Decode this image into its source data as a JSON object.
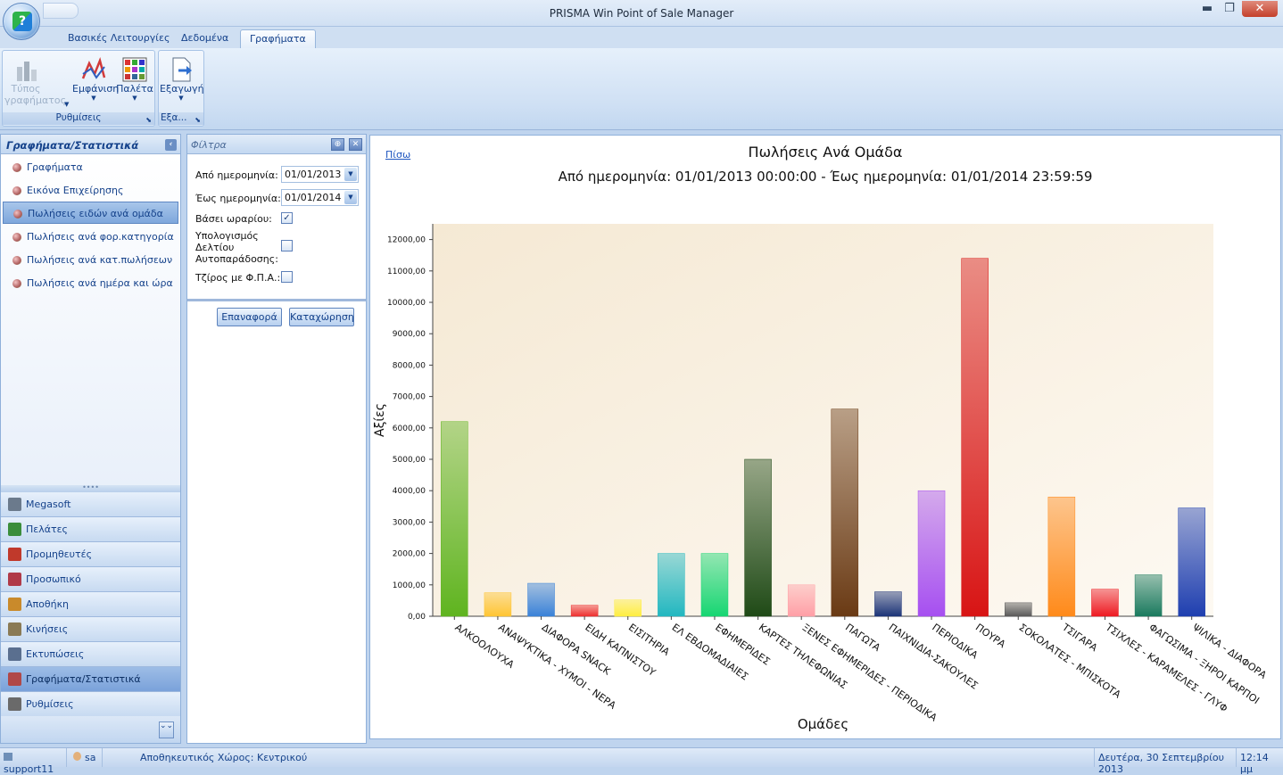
{
  "window": {
    "title": "PRISMA Win Point of Sale Manager",
    "minimize": "▬",
    "maximize": "❐",
    "close": "✕"
  },
  "tabs": [
    {
      "label": "Βασικές Λειτουργίες"
    },
    {
      "label": "Δεδομένα"
    },
    {
      "label": "Γραφήματα",
      "active": true
    }
  ],
  "ribbon": {
    "groups": [
      {
        "label": "Ρυθμίσεις",
        "buttons": [
          {
            "label": "Τύπος γραφήματος",
            "icon": "chart-type-icon",
            "disabled": true
          },
          {
            "label": "Εμφάνιση",
            "icon": "appearance-icon"
          },
          {
            "label": "Παλέτα",
            "icon": "palette-icon"
          }
        ]
      },
      {
        "label": "Εξα...",
        "buttons": [
          {
            "label": "Εξαγωγή",
            "icon": "export-icon"
          }
        ]
      }
    ]
  },
  "nav": {
    "header": "Γραφήματα/Στατιστικά",
    "collapse_icon": "‹",
    "items": [
      {
        "label": "Γραφήματα"
      },
      {
        "label": "Εικόνα Επιχείρησης"
      },
      {
        "label": "Πωλήσεις ειδών ανά ομάδα",
        "selected": true
      },
      {
        "label": "Πωλήσεις ανά φορ.κατηγορία"
      },
      {
        "label": "Πωλήσεις ανά κατ.πωλήσεων"
      },
      {
        "label": "Πωλήσεις ανά ημέρα και ώρα"
      }
    ],
    "splitter": "••••",
    "modules": [
      {
        "label": "Megasoft",
        "icon": "megasoft-icon",
        "color": "#6b7a8c"
      },
      {
        "label": "Πελάτες",
        "icon": "customers-icon",
        "color": "#3b8d3b"
      },
      {
        "label": "Προμηθευτές",
        "icon": "suppliers-icon",
        "color": "#c0392b"
      },
      {
        "label": "Προσωπικό",
        "icon": "staff-icon",
        "color": "#b03a48"
      },
      {
        "label": "Αποθήκη",
        "icon": "warehouse-icon",
        "color": "#c98a2b"
      },
      {
        "label": "Κινήσεις",
        "icon": "transactions-icon",
        "color": "#8a7a55"
      },
      {
        "label": "Εκτυπώσεις",
        "icon": "printouts-icon",
        "color": "#5a6f8f"
      },
      {
        "label": "Γραφήματα/Στατιστικά",
        "icon": "charts-icon",
        "color": "#b04848",
        "selected": true
      },
      {
        "label": "Ρυθμίσεις",
        "icon": "settings-icon",
        "color": "#6a6a6a"
      }
    ],
    "more_icon": "⌄⌄"
  },
  "filter": {
    "header": "Φίλτρα",
    "pin_icon": "⊕",
    "close_icon": "✕",
    "from_label": "Από ημερομηνία:",
    "from_value": "01/01/2013 00:00:00",
    "to_label": "Έως ημερομηνία:",
    "to_value": "01/01/2014 23:59:59",
    "hours_label": "Βάσει ωραρίου:",
    "hours_checked": "✓",
    "delivery_label": "Υπολογισμός Δελτίου Αυτοπαράδοσης:",
    "vat_label": "Τζίρος με Φ.Π.Α.:",
    "reset_button": "Επαναφορά",
    "submit_button": "Καταχώρηση",
    "dropdown_icon": "▼"
  },
  "chart_panel": {
    "back_link": "Πίσω"
  },
  "chart_data": {
    "type": "bar",
    "title": "Πωλήσεις Ανά Ομάδα",
    "subtitle": "Από ημερομηνία: 01/01/2013 00:00:00 - Έως ημερομηνία: 01/01/2014 23:59:59",
    "xlabel": "Ομάδες",
    "ylabel": "Αξίες",
    "ylim": [
      0,
      12500
    ],
    "yticks": [
      "0,00",
      "1000,00",
      "2000,00",
      "3000,00",
      "4000,00",
      "5000,00",
      "6000,00",
      "7000,00",
      "8000,00",
      "9000,00",
      "10000,00",
      "11000,00",
      "12000,00"
    ],
    "ytick_values": [
      0,
      1000,
      2000,
      3000,
      4000,
      5000,
      6000,
      7000,
      8000,
      9000,
      10000,
      11000,
      12000
    ],
    "categories": [
      "ΑΛΚΟΟΛΟΥΧΑ",
      "ΑΝΑΨΥΚΤΙΚΑ - ΧΥΜΟΙ - ΝΕΡΑ",
      "ΔΙΑΦΟΡΑ SNACK",
      "ΕΙΔΗ ΚΑΠΝΙΣΤΟΥ",
      "ΕΙΣΙΤΗΡΙΑ",
      "ΕΛ ΕΒΔΟΜΑΔΙΑΙΕΣ",
      "ΕΦΗΜΕΡΙΔΕΣ",
      "ΚΑΡΤΕΣ ΤΗΛΕΦΩΝΙΑΣ",
      "ΞΕΝΕΣ ΕΦΗΜΕΡΙΔΕΣ - ΠΕΡΙΟΔΙΚΑ",
      "ΠΑΓΩΤΑ",
      "ΠΑΙΧΝΙΔΙΑ-ΣΑΚΟΥΛΕΣ",
      "ΠΕΡΙΟΔΙΚΑ",
      "ΠΟΥΡΑ",
      "ΣΟΚΟΛΑΤΕΣ - ΜΠΙΣΚΟΤΑ",
      "ΤΣΙΓΑΡΑ",
      "ΤΣΙΧΛΕΣ - ΚΑΡΑΜΕΛΕΣ - ΓΛΥΦ",
      "ΦΑΓΩΣΙΜΑ - ΞΗΡΟΙ ΚΑΡΠΟΙ",
      "ΨΙΛΙΚΑ - ΔΙΑΦΟΡΑ"
    ],
    "values": [
      6200,
      750,
      1050,
      350,
      520,
      2000,
      2000,
      5000,
      1000,
      6600,
      780,
      4000,
      11400,
      430,
      3800,
      860,
      1320,
      3450
    ],
    "colors": [
      "#5fb41f",
      "#ffc533",
      "#3a82d8",
      "#ee3030",
      "#ffee40",
      "#22b7c0",
      "#16d672",
      "#1f4a16",
      "#ff9fa6",
      "#6a3a14",
      "#1c3478",
      "#a64ff0",
      "#d81414",
      "#5a5a5a",
      "#ff8a1a",
      "#ee1a22",
      "#1a7a5e",
      "#1f3fb0"
    ],
    "grid": false,
    "background": "#f8eedd"
  },
  "status": {
    "user_host": "support11",
    "user": "sa",
    "warehouse": "Αποθηκευτικός Χώρος: Κεντρικού",
    "date": "Δευτέρα, 30 Σεπτεμβρίου 2013",
    "time": "12:14 μμ"
  }
}
